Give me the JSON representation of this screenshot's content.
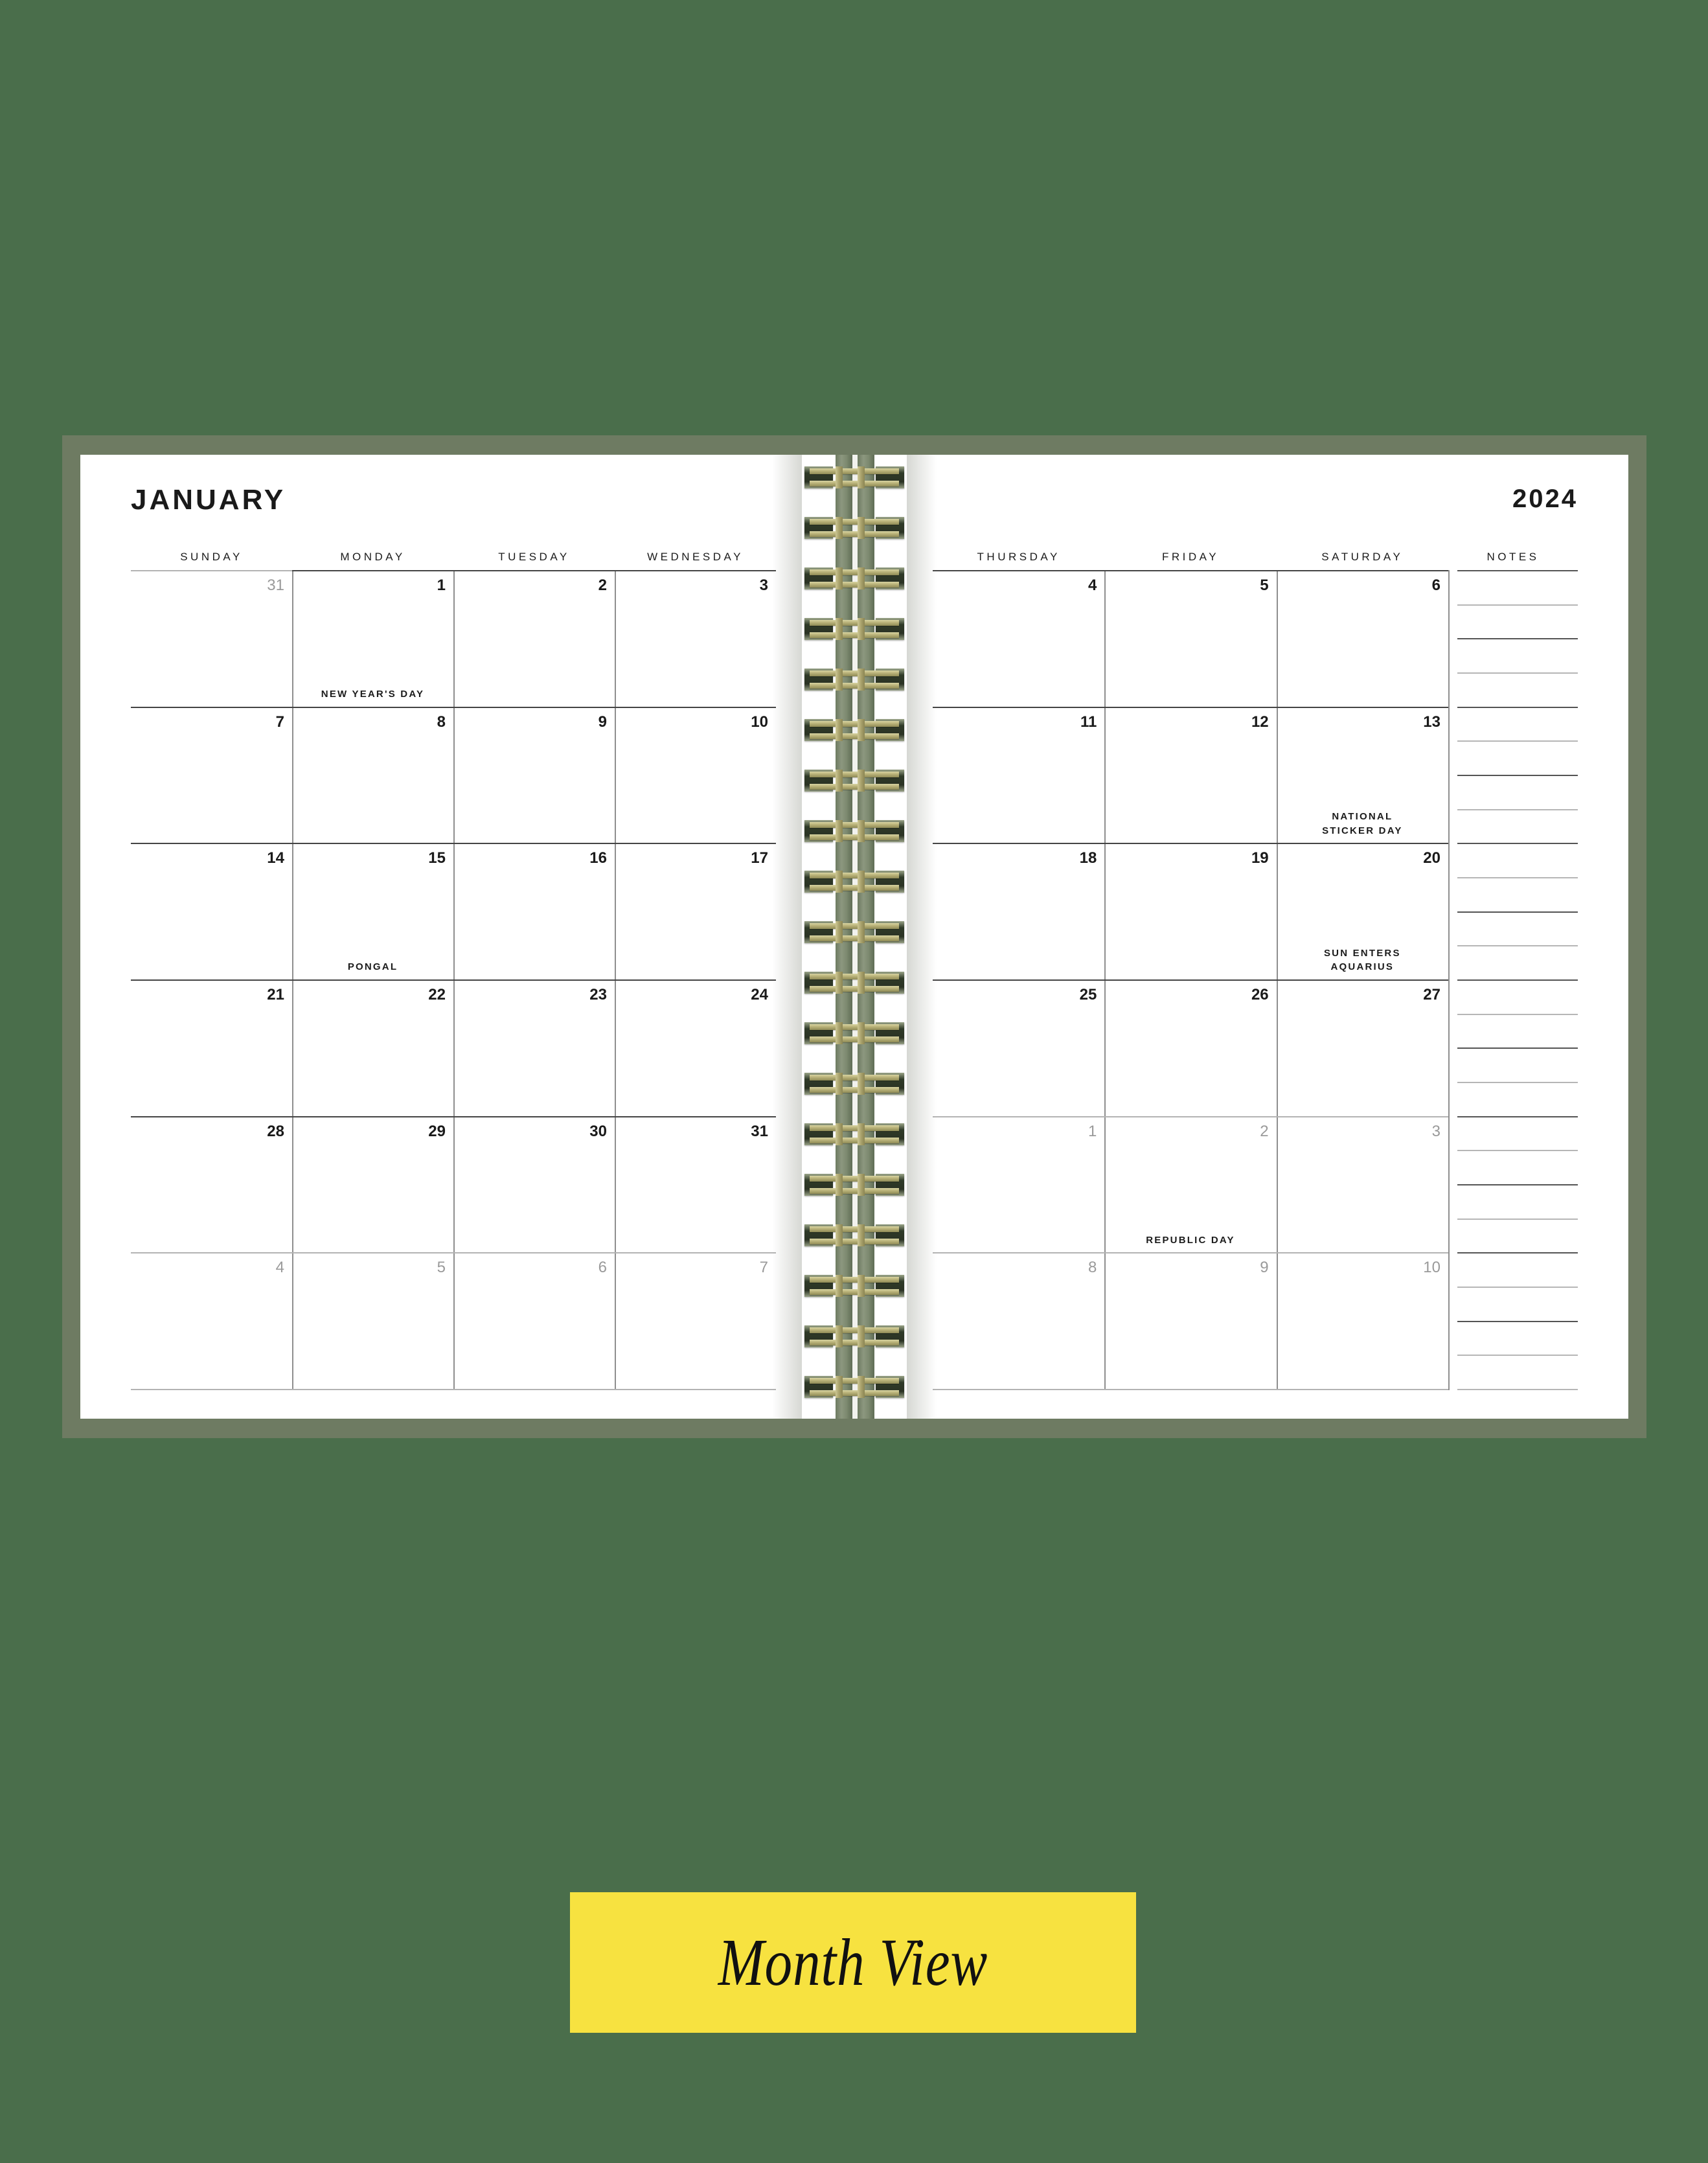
{
  "background_color": "#4a6e4b",
  "cover_color": "#6e7b62",
  "caption": {
    "label": "Month View",
    "background_color": "#f7e240",
    "text_color": "#111111"
  },
  "left_page": {
    "month": "JANUARY",
    "day_headers": [
      "SUNDAY",
      "MONDAY",
      "TUESDAY",
      "WEDNESDAY"
    ],
    "weeks": [
      [
        {
          "date": "31",
          "muted": true,
          "event": ""
        },
        {
          "date": "1",
          "muted": false,
          "event": "NEW YEAR'S DAY"
        },
        {
          "date": "2",
          "muted": false,
          "event": ""
        },
        {
          "date": "3",
          "muted": false,
          "event": ""
        }
      ],
      [
        {
          "date": "7",
          "muted": false,
          "event": ""
        },
        {
          "date": "8",
          "muted": false,
          "event": ""
        },
        {
          "date": "9",
          "muted": false,
          "event": ""
        },
        {
          "date": "10",
          "muted": false,
          "event": ""
        }
      ],
      [
        {
          "date": "14",
          "muted": false,
          "event": ""
        },
        {
          "date": "15",
          "muted": false,
          "event": "PONGAL"
        },
        {
          "date": "16",
          "muted": false,
          "event": ""
        },
        {
          "date": "17",
          "muted": false,
          "event": ""
        }
      ],
      [
        {
          "date": "21",
          "muted": false,
          "event": ""
        },
        {
          "date": "22",
          "muted": false,
          "event": ""
        },
        {
          "date": "23",
          "muted": false,
          "event": ""
        },
        {
          "date": "24",
          "muted": false,
          "event": ""
        }
      ],
      [
        {
          "date": "28",
          "muted": false,
          "event": ""
        },
        {
          "date": "29",
          "muted": false,
          "event": ""
        },
        {
          "date": "30",
          "muted": false,
          "event": ""
        },
        {
          "date": "31",
          "muted": false,
          "event": ""
        }
      ],
      [
        {
          "date": "4",
          "muted": true,
          "event": ""
        },
        {
          "date": "5",
          "muted": true,
          "event": ""
        },
        {
          "date": "6",
          "muted": true,
          "event": ""
        },
        {
          "date": "7",
          "muted": true,
          "event": ""
        }
      ]
    ]
  },
  "right_page": {
    "year": "2024",
    "day_headers": [
      "THURSDAY",
      "FRIDAY",
      "SATURDAY"
    ],
    "notes_header": "NOTES",
    "weeks": [
      [
        {
          "date": "4",
          "muted": false,
          "event": ""
        },
        {
          "date": "5",
          "muted": false,
          "event": ""
        },
        {
          "date": "6",
          "muted": false,
          "event": ""
        }
      ],
      [
        {
          "date": "11",
          "muted": false,
          "event": ""
        },
        {
          "date": "12",
          "muted": false,
          "event": ""
        },
        {
          "date": "13",
          "muted": false,
          "event": "NATIONAL\nSTICKER DAY"
        }
      ],
      [
        {
          "date": "18",
          "muted": false,
          "event": ""
        },
        {
          "date": "19",
          "muted": false,
          "event": ""
        },
        {
          "date": "20",
          "muted": false,
          "event": "SUN ENTERS\nAQUARIUS"
        }
      ],
      [
        {
          "date": "25",
          "muted": false,
          "event": ""
        },
        {
          "date": "26",
          "muted": false,
          "event": ""
        },
        {
          "date": "27",
          "muted": false,
          "event": ""
        }
      ],
      [
        {
          "date": "1",
          "muted": true,
          "event": ""
        },
        {
          "date": "2",
          "muted": true,
          "event": "REPUBLIC DAY"
        },
        {
          "date": "3",
          "muted": true,
          "event": ""
        }
      ],
      [
        {
          "date": "8",
          "muted": true,
          "event": ""
        },
        {
          "date": "9",
          "muted": true,
          "event": ""
        },
        {
          "date": "10",
          "muted": true,
          "event": ""
        }
      ]
    ],
    "notes_line_count": 24
  },
  "binding": {
    "coil_count": 19,
    "wire_color": "#b9b278",
    "spine_color": "#7d8a70"
  }
}
